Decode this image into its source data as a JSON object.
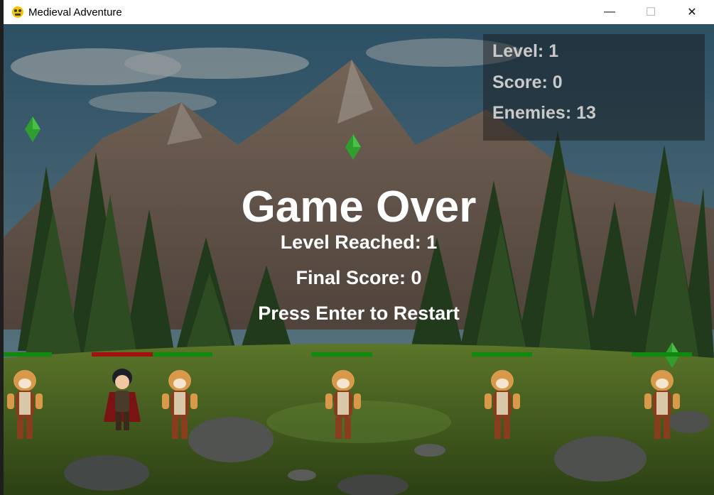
{
  "window": {
    "title": "Medieval Adventure",
    "minimize_glyph": "—",
    "maximize_glyph": "☐",
    "close_glyph": "✕"
  },
  "hud": {
    "level_text": "Level: 1",
    "score_text": "Score: 0",
    "enemies_text": "Enemies: 13"
  },
  "game_over": {
    "title": "Game Over",
    "level_reached": "Level Reached: 1",
    "final_score": "Final Score: 0",
    "restart_prompt": "Press Enter to Restart"
  },
  "colors": {
    "health_bar_full": "#0f8a0f",
    "health_bar_player": "#a50f0f",
    "gem": "#2f9e2f"
  },
  "icons": {
    "app": "python-pygame-icon",
    "gem": "green-gem-icon"
  }
}
